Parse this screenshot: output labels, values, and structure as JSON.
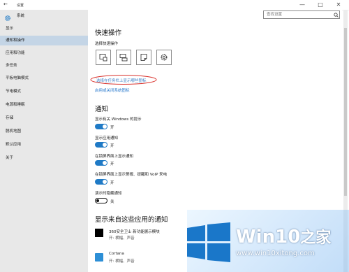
{
  "window": {
    "title": "设置",
    "app_name": "系统",
    "search_placeholder": "查找设置",
    "controls": {
      "back": "←",
      "minimize": "—",
      "maximize": "□",
      "close": "✕"
    }
  },
  "sidebar": {
    "items": [
      {
        "label": "显示"
      },
      {
        "label": "通知和操作"
      },
      {
        "label": "应用和功能"
      },
      {
        "label": "多任务"
      },
      {
        "label": "平板电脑模式"
      },
      {
        "label": "节电模式"
      },
      {
        "label": "电源和睡眠"
      },
      {
        "label": "存储"
      },
      {
        "label": "脱机地图"
      },
      {
        "label": "默认应用"
      },
      {
        "label": "关于"
      }
    ],
    "active_index": 1
  },
  "quick_actions": {
    "heading": "快速操作",
    "subheading": "选择快速操作",
    "buttons": [
      {
        "icon": "tablet-mode-icon"
      },
      {
        "icon": "connect-display-icon"
      },
      {
        "icon": "note-icon"
      },
      {
        "icon": "settings-gear-icon"
      }
    ],
    "taskbar_link": "选择在任务栏上显示哪些图标",
    "system_icons_link": "启用或关闭系统图标"
  },
  "notifications": {
    "heading": "通知",
    "settings": [
      {
        "label": "显示有关 Windows 的提示",
        "state": "开",
        "on": true
      },
      {
        "label": "显示应用通知",
        "state": "开",
        "on": true
      },
      {
        "label": "在锁屏界面上显示通知",
        "state": "开",
        "on": true
      },
      {
        "label": "在锁屏界面上显示警报、提醒和 VoIP 来电",
        "state": "开",
        "on": true
      },
      {
        "label": "演示时隐藏通知",
        "state": "关",
        "on": false
      }
    ]
  },
  "app_notifications": {
    "heading": "显示来自这些应用的通知",
    "apps": [
      {
        "name": "360安全卫士 新功能展示模块",
        "status": "开: 横幅、声音"
      },
      {
        "name": "Cortana",
        "status": "开: 横幅、声音"
      }
    ]
  },
  "watermark": {
    "brand": "Win10",
    "brand_suffix": "之家",
    "url": "www.win10xitong.com"
  },
  "colors": {
    "accent": "#1f7ac6",
    "link": "#2a7acd",
    "highlight_circle": "#d9312b",
    "sidebar_bg": "#e8e8e8",
    "sidebar_active": "#c4d5e6"
  }
}
